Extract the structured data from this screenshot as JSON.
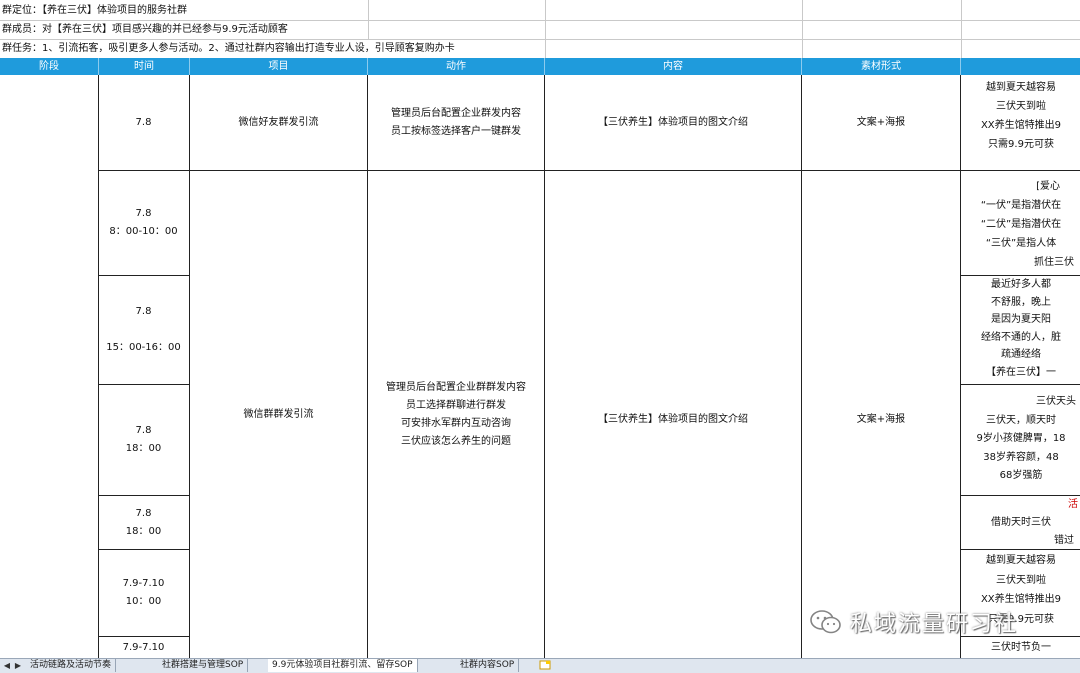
{
  "info": {
    "positioning": "群定位：【养在三伏】体验项目的服务社群",
    "members": "群成员：对【养在三伏】项目感兴趣的并已经参与9.9元活动顾客",
    "task": "群任务：1、引流拓客，吸引更多人参与活动。2、通过社群内容输出打造专业人设，引导顾客复购办卡"
  },
  "headers": [
    "阶段",
    "时间",
    "项目",
    "动作",
    "内容",
    "素材形式",
    ""
  ],
  "rows": {
    "r1": {
      "time": [
        "7.8"
      ],
      "project": "微信好友群发引流",
      "action": [
        "管理员后台配置企业群发内容",
        "员工按标签选择客户一键群发"
      ],
      "content": "【三伏养生】体验项目的图文介绍",
      "material": "文案+海报",
      "right": [
        "越到夏天越容易",
        "三伏天到啦",
        "XX养生馆特推出9",
        "只需9.9元可获"
      ]
    },
    "g2": {
      "project": "微信群群发引流",
      "action": [
        "管理员后台配置企业群群发内容",
        "员工选择群聊进行群发",
        "可安排水军群内互动咨询",
        "三伏应该怎么养生的问题"
      ],
      "content": "【三伏养生】体验项目的图文介绍",
      "material": "文案+海报"
    },
    "t2": {
      "time": [
        "7.8",
        "8：00-10：00"
      ],
      "right": [
        "[爱心",
        "“一伏”是指潜伏在",
        "“二伏”是指潜伏在",
        "“三伏”是指人体",
        "抓住三伏"
      ]
    },
    "t3": {
      "time": [
        "7.8",
        "",
        "15：00-16：00"
      ],
      "right": [
        "最近好多人都",
        "不舒服，晚上",
        "是因为夏天阳",
        "经络不通的人，脏",
        "疏通经络",
        "【养在三伏】一"
      ]
    },
    "t4": {
      "time": [
        "7.8",
        "18：00"
      ],
      "right": [
        "三伏天头",
        "三伏天，顺天时",
        "9岁小孩健脾胃，18",
        "38岁养容颜，48",
        "68岁强筋"
      ]
    },
    "t5": {
      "time": [
        "7.8",
        "18：00"
      ],
      "right": [
        "活",
        "借助天时三伏",
        "错过"
      ]
    },
    "t6": {
      "time": [
        "7.9-7.10",
        "10：00"
      ],
      "right": [
        "越到夏天越容易",
        "三伏天到啦",
        "XX养生馆特推出9",
        "只需9.9元可获"
      ]
    },
    "t7": {
      "time": [
        "7.9-7.10"
      ],
      "right": [
        "三伏时节负一"
      ]
    }
  },
  "tabs": [
    "活动链路及活动节奏",
    "社群搭建与管理SOP",
    "9.9元体验项目社群引流、留存SOP",
    "社群内容SOP"
  ],
  "nav": [
    "◀",
    "▶"
  ],
  "watermark": {
    "text": "私域流量研习社",
    "icon": "wechat-icon"
  }
}
